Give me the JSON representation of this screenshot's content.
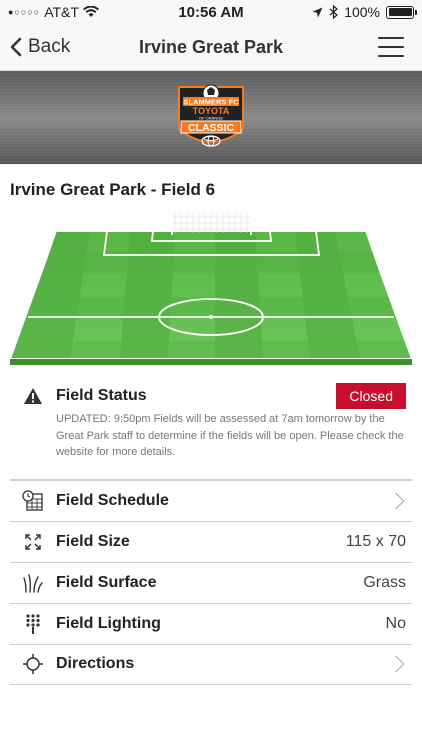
{
  "status_bar": {
    "carrier": "AT&T",
    "signal_dots": "●○○○○",
    "time": "10:56 AM",
    "battery": "100%",
    "battery_level": 1.0
  },
  "nav": {
    "back_label": "Back",
    "title": "Irvine Great Park",
    "menu_icon": "hamburger-icon"
  },
  "banner": {
    "logo_lines": [
      "SLAMMERS FC",
      "TOYOTA",
      "OF ORANGE",
      "CLASSIC"
    ]
  },
  "field": {
    "title": "Irvine Great Park - Field 6"
  },
  "status": {
    "label": "Field Status",
    "badge": "Closed",
    "badge_color": "#c8102e",
    "description": "UPDATED: 9:50pm Fields will be assessed at 7am tomorrow by the Great Park staff to determine if the fields will be open. Please check the website for more details."
  },
  "details": [
    {
      "label": "Field Schedule",
      "value": "",
      "icon": "schedule-icon",
      "chevron": true
    },
    {
      "label": "Field Size",
      "value": "115 x 70",
      "icon": "expand-icon",
      "chevron": false
    },
    {
      "label": "Field Surface",
      "value": "Grass",
      "icon": "grass-icon",
      "chevron": false
    },
    {
      "label": "Field Lighting",
      "value": "No",
      "icon": "lighting-icon",
      "chevron": false
    },
    {
      "label": "Directions",
      "value": "",
      "icon": "directions-icon",
      "chevron": true
    }
  ]
}
